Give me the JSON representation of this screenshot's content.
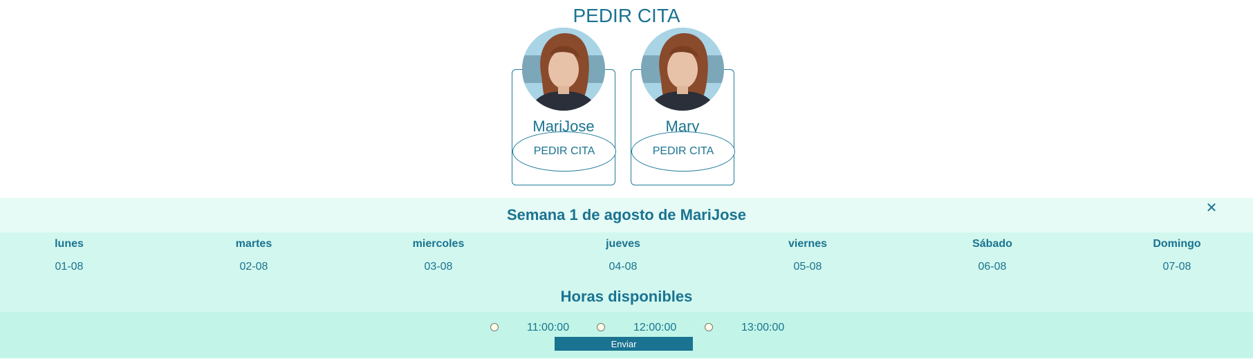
{
  "header": {
    "title": "PEDIR CITA"
  },
  "professionals": [
    {
      "name": "MariJose",
      "button_label": "PEDIR CITA"
    },
    {
      "name": "Mary",
      "button_label": "PEDIR CITA"
    }
  ],
  "week": {
    "title": "Semana 1 de agosto de MariJose",
    "close_symbol": "✕",
    "days": [
      {
        "name": "lunes",
        "date": "01-08"
      },
      {
        "name": "martes",
        "date": "02-08"
      },
      {
        "name": "miercoles",
        "date": "03-08"
      },
      {
        "name": "jueves",
        "date": "04-08"
      },
      {
        "name": "viernes",
        "date": "05-08"
      },
      {
        "name": "Sábado",
        "date": "06-08"
      },
      {
        "name": "Domingo",
        "date": "07-08"
      }
    ]
  },
  "hours": {
    "title": "Horas disponibles",
    "slots": [
      "11:00:00",
      "12:00:00",
      "13:00:00"
    ],
    "submit_label": "Enviar"
  },
  "colors": {
    "primary": "#1a7391",
    "header_bg": "#e6fbf5",
    "days_bg": "#d2f7ee",
    "slots_bg": "#c2f5e8"
  }
}
